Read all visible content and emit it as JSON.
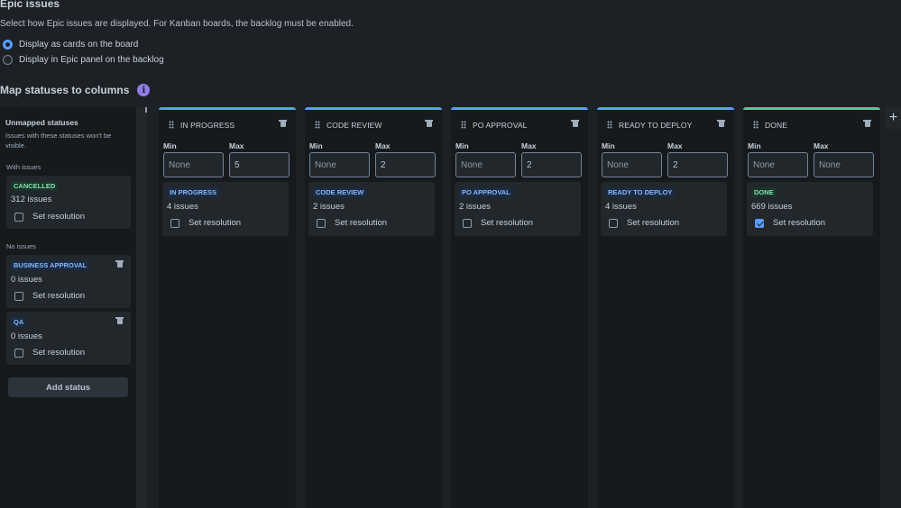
{
  "epic": {
    "title": "Epic issues",
    "description": "Select how Epic issues are displayed. For Kanban boards, the backlog must be enabled.",
    "options": [
      {
        "label": "Display as cards on the board",
        "selected": true
      },
      {
        "label": "Display in Epic panel on the backlog",
        "selected": false
      }
    ]
  },
  "map": {
    "title": "Map statuses to columns",
    "info_icon": "i"
  },
  "unmapped": {
    "title": "Unmapped statuses",
    "subtitle": "Issues with these statuses won't be visible.",
    "with_issues_label": "With issues",
    "no_issues_label": "No issues",
    "with_issues": [
      {
        "status": "CANCELLED",
        "count": "312",
        "count_suffix": " issues",
        "set_resolution": "Set resolution",
        "checked": false
      }
    ],
    "no_issues": [
      {
        "status": "BUSINESS APPROVAL",
        "count": "0",
        "count_suffix": " issues",
        "set_resolution": "Set resolution",
        "checked": false
      },
      {
        "status": "QA",
        "count": "0",
        "count_suffix": " issues",
        "set_resolution": "Set resolution",
        "checked": false
      }
    ],
    "add_status": "Add status"
  },
  "columns": [
    {
      "name": "IN PROGRESS",
      "min_label": "Min",
      "max_label": "Max",
      "min": "None",
      "max": "5",
      "status": "IN PROGRESS",
      "count": "4",
      "count_suffix": " issues",
      "set_resolution": "Set resolution",
      "checked": false
    },
    {
      "name": "CODE REVIEW",
      "min_label": "Min",
      "max_label": "Max",
      "min": "None",
      "max": "2",
      "status": "CODE REVIEW",
      "count": "2",
      "count_suffix": " issues",
      "set_resolution": "Set resolution",
      "checked": false
    },
    {
      "name": "PO APPROVAL",
      "min_label": "Min",
      "max_label": "Max",
      "min": "None",
      "max": "2",
      "status": "PO APPROVAL",
      "count": "2",
      "count_suffix": " issues",
      "set_resolution": "Set resolution",
      "checked": false
    },
    {
      "name": "READY TO DEPLOY",
      "min_label": "Min",
      "max_label": "Max",
      "min": "None",
      "max": "2",
      "status": "READY TO DEPLOY",
      "count": "4",
      "count_suffix": " issues",
      "set_resolution": "Set resolution",
      "checked": false
    },
    {
      "name": "DONE",
      "min_label": "Min",
      "max_label": "Max",
      "min": "None",
      "max": "None",
      "status": "DONE",
      "count": "669",
      "count_suffix": " issues",
      "set_resolution": "Set resolution",
      "checked": true
    }
  ],
  "colors": {
    "accent_blue": "#579dff",
    "done_green": "#4bce97",
    "background": "#1d2125"
  },
  "icons": {
    "trash": "trash-icon",
    "drag": "drag-handle-icon",
    "add_column": "+"
  }
}
